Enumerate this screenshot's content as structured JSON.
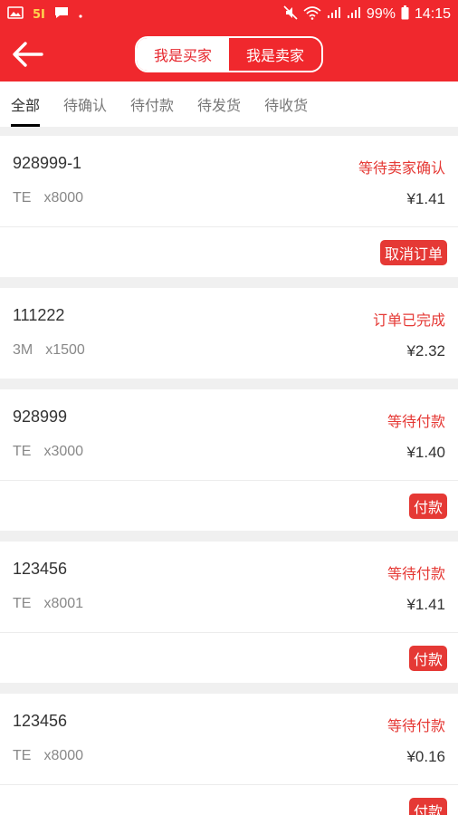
{
  "status_bar": {
    "left_icons": [
      "gallery-icon",
      "app-51-icon",
      "message-icon",
      "dot-icon"
    ],
    "app_badge": "5I",
    "battery": "99%",
    "time": "14:15"
  },
  "header": {
    "back_icon": "arrow-left-icon",
    "segment": {
      "buyer_label": "我是买家",
      "seller_label": "我是卖家",
      "active": "seller"
    }
  },
  "tabs": [
    {
      "label": "全部",
      "active": true
    },
    {
      "label": "待确认",
      "active": false
    },
    {
      "label": "待付款",
      "active": false
    },
    {
      "label": "待发货",
      "active": false
    },
    {
      "label": "待收货",
      "active": false
    }
  ],
  "orders": [
    {
      "order_no": "928999-1",
      "status": "等待卖家确认",
      "brand": "TE",
      "qty": "x8000",
      "price": "¥1.41",
      "action": "取消订单"
    },
    {
      "order_no": "111222",
      "status": "订单已完成",
      "brand": "3M",
      "qty": "x1500",
      "price": "¥2.32",
      "action": null
    },
    {
      "order_no": "928999",
      "status": "等待付款",
      "brand": "TE",
      "qty": "x3000",
      "price": "¥1.40",
      "action": "付款"
    },
    {
      "order_no": "123456",
      "status": "等待付款",
      "brand": "TE",
      "qty": "x8001",
      "price": "¥1.41",
      "action": "付款"
    },
    {
      "order_no": "123456",
      "status": "等待付款",
      "brand": "TE",
      "qty": "x8000",
      "price": "¥0.16",
      "action": "付款"
    }
  ],
  "colors": {
    "brand_red": "#f0282d",
    "status_red": "#e53935",
    "background": "#f0f0f0"
  }
}
